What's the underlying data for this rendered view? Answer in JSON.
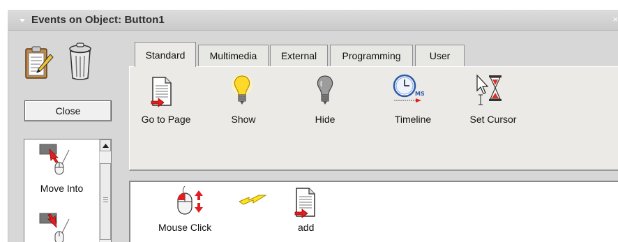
{
  "window": {
    "title": "Events on Object: Button1",
    "close_glyph": "×"
  },
  "toolbar": {
    "icons": [
      "clipboard-edit-icon",
      "trash-can-icon"
    ],
    "close_label": "Close"
  },
  "triggers": {
    "items": [
      {
        "label": "Move Into",
        "icon": "mouse-move-into-icon"
      },
      {
        "label": "",
        "icon": "mouse-move-out-icon"
      }
    ]
  },
  "tabs": [
    {
      "label": "Standard",
      "active": true
    },
    {
      "label": "Multimedia",
      "active": false
    },
    {
      "label": "External",
      "active": false
    },
    {
      "label": "Programming",
      "active": false
    },
    {
      "label": "User",
      "active": false
    }
  ],
  "actions": [
    {
      "label": "Go to Page",
      "icon": "document-go-icon"
    },
    {
      "label": "Show",
      "icon": "lightbulb-on-icon"
    },
    {
      "label": "Hide",
      "icon": "lightbulb-off-icon"
    },
    {
      "label": "Timeline",
      "icon": "clock-timeline-icon"
    },
    {
      "label": "Set Cursor",
      "icon": "cursor-hourglass-icon"
    }
  ],
  "event": {
    "trigger_label": "Mouse Click",
    "action_label": "add",
    "icons": [
      "mouse-click-icon",
      "lightning-bolt-icon",
      "document-go-icon"
    ]
  },
  "colors": {
    "panel": "#ebeae6",
    "frame": "#d7d7d7",
    "title_text": "#2f2f2f",
    "red_arrow": "#e02020",
    "bulb_on": "#ffd92a"
  }
}
